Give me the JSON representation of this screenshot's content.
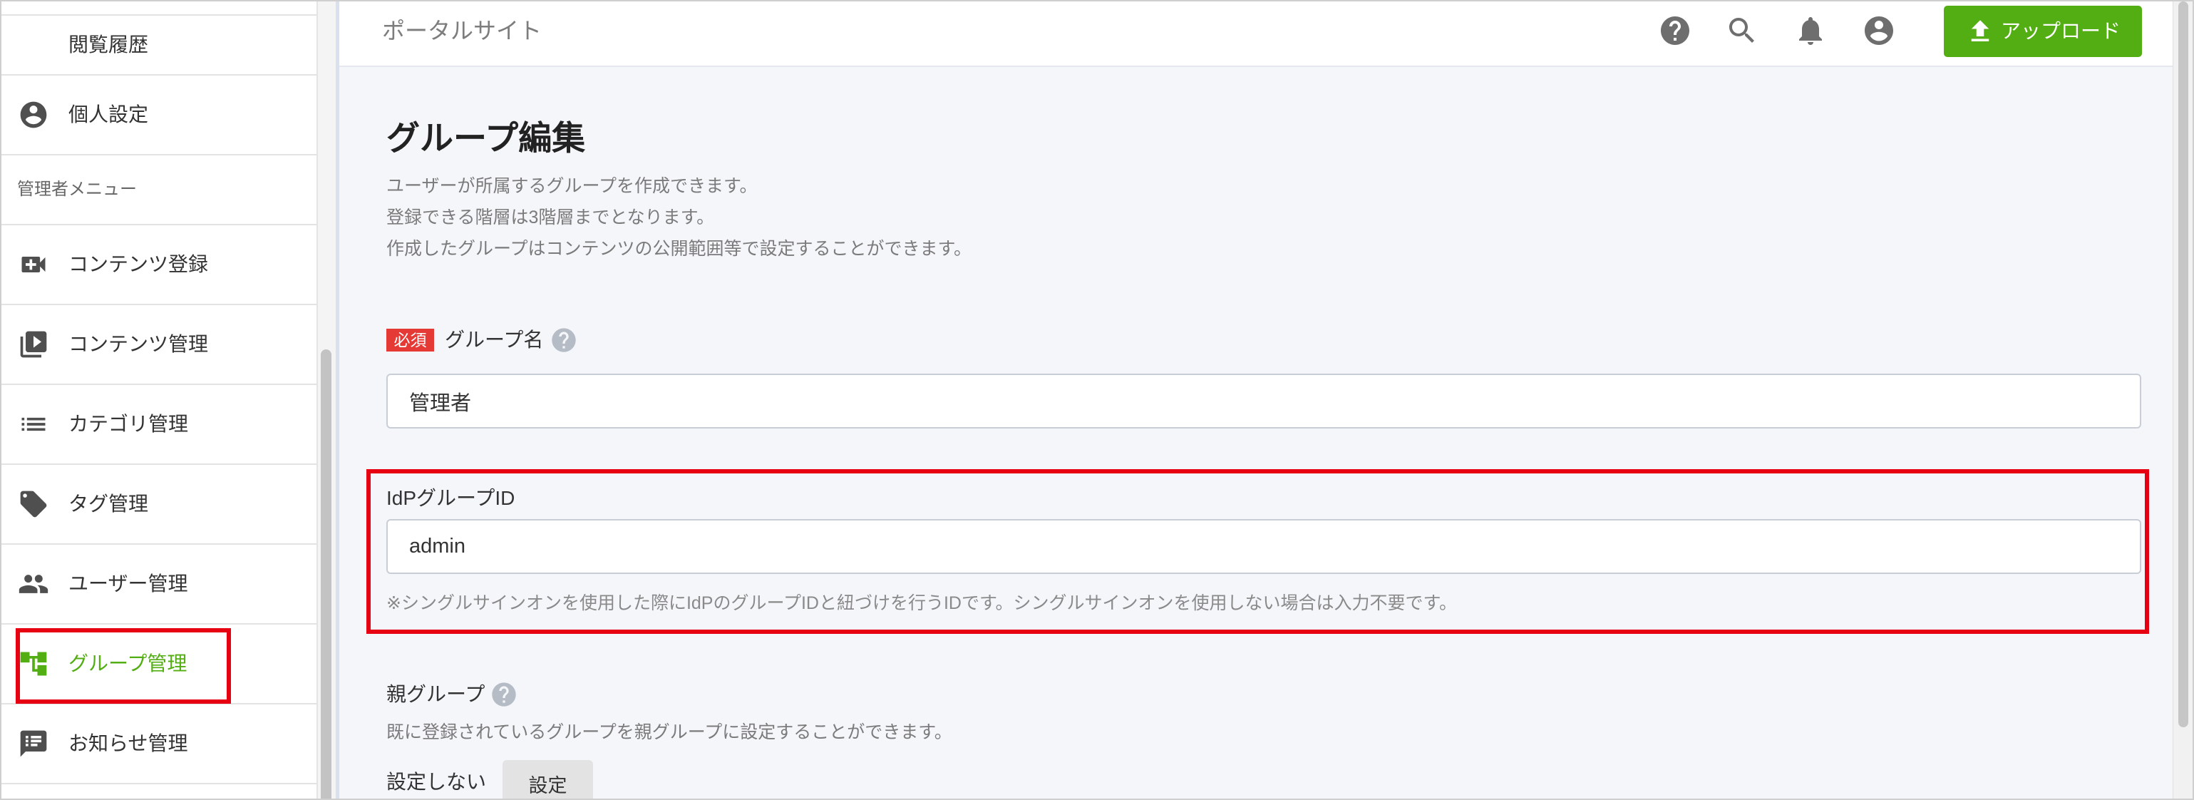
{
  "header": {
    "site_title": "ポータルサイト",
    "icons": [
      "help-icon",
      "search-icon",
      "notifications-icon",
      "account-circle-icon"
    ],
    "upload_button": {
      "label": "アップロード",
      "icon": "upload-icon"
    }
  },
  "sidebar": {
    "items_top": [
      {
        "label": "閲覧履歴"
      },
      {
        "label": "個人設定",
        "icon": "account-circle-icon"
      }
    ],
    "admin_heading": "管理者メニュー",
    "admin_items": [
      {
        "label": "コンテンツ登録",
        "icon": "video-add-icon"
      },
      {
        "label": "コンテンツ管理",
        "icon": "video-library-icon"
      },
      {
        "label": "カテゴリ管理",
        "icon": "list-icon"
      },
      {
        "label": "タグ管理",
        "icon": "tag-icon"
      },
      {
        "label": "ユーザー管理",
        "icon": "people-icon"
      },
      {
        "label": "グループ管理",
        "icon": "account-tree-icon",
        "active": true
      },
      {
        "label": "お知らせ管理",
        "icon": "speaker-notes-icon"
      }
    ]
  },
  "main": {
    "page_title": "グループ編集",
    "description": [
      "ユーザーが所属するグループを作成できます。",
      "登録できる階層は3階層までとなります。",
      "作成したグループはコンテンツの公開範囲等で設定することができます。"
    ],
    "group_name": {
      "required_badge": "必須",
      "label": "グループ名",
      "value": "管理者",
      "help_icon": "help-icon"
    },
    "idp_group_id": {
      "label": "IdPグループID",
      "value": "admin",
      "note": "※シングルサインオンを使用した際にIdPのグループIDと紐づけを行うIDです。シングルサインオンを使用しない場合は入力不要です。"
    },
    "parent_group": {
      "label": "親グループ",
      "help_icon": "help-icon",
      "description": "既に登録されているグループを親グループに設定することができます。",
      "current_value": "設定しない",
      "set_button": "設定"
    }
  },
  "colors": {
    "accent": "#53ae13",
    "required_badge": "#e53935",
    "annotation_outline": "#e60012",
    "content_background": "#f4f6fa"
  }
}
